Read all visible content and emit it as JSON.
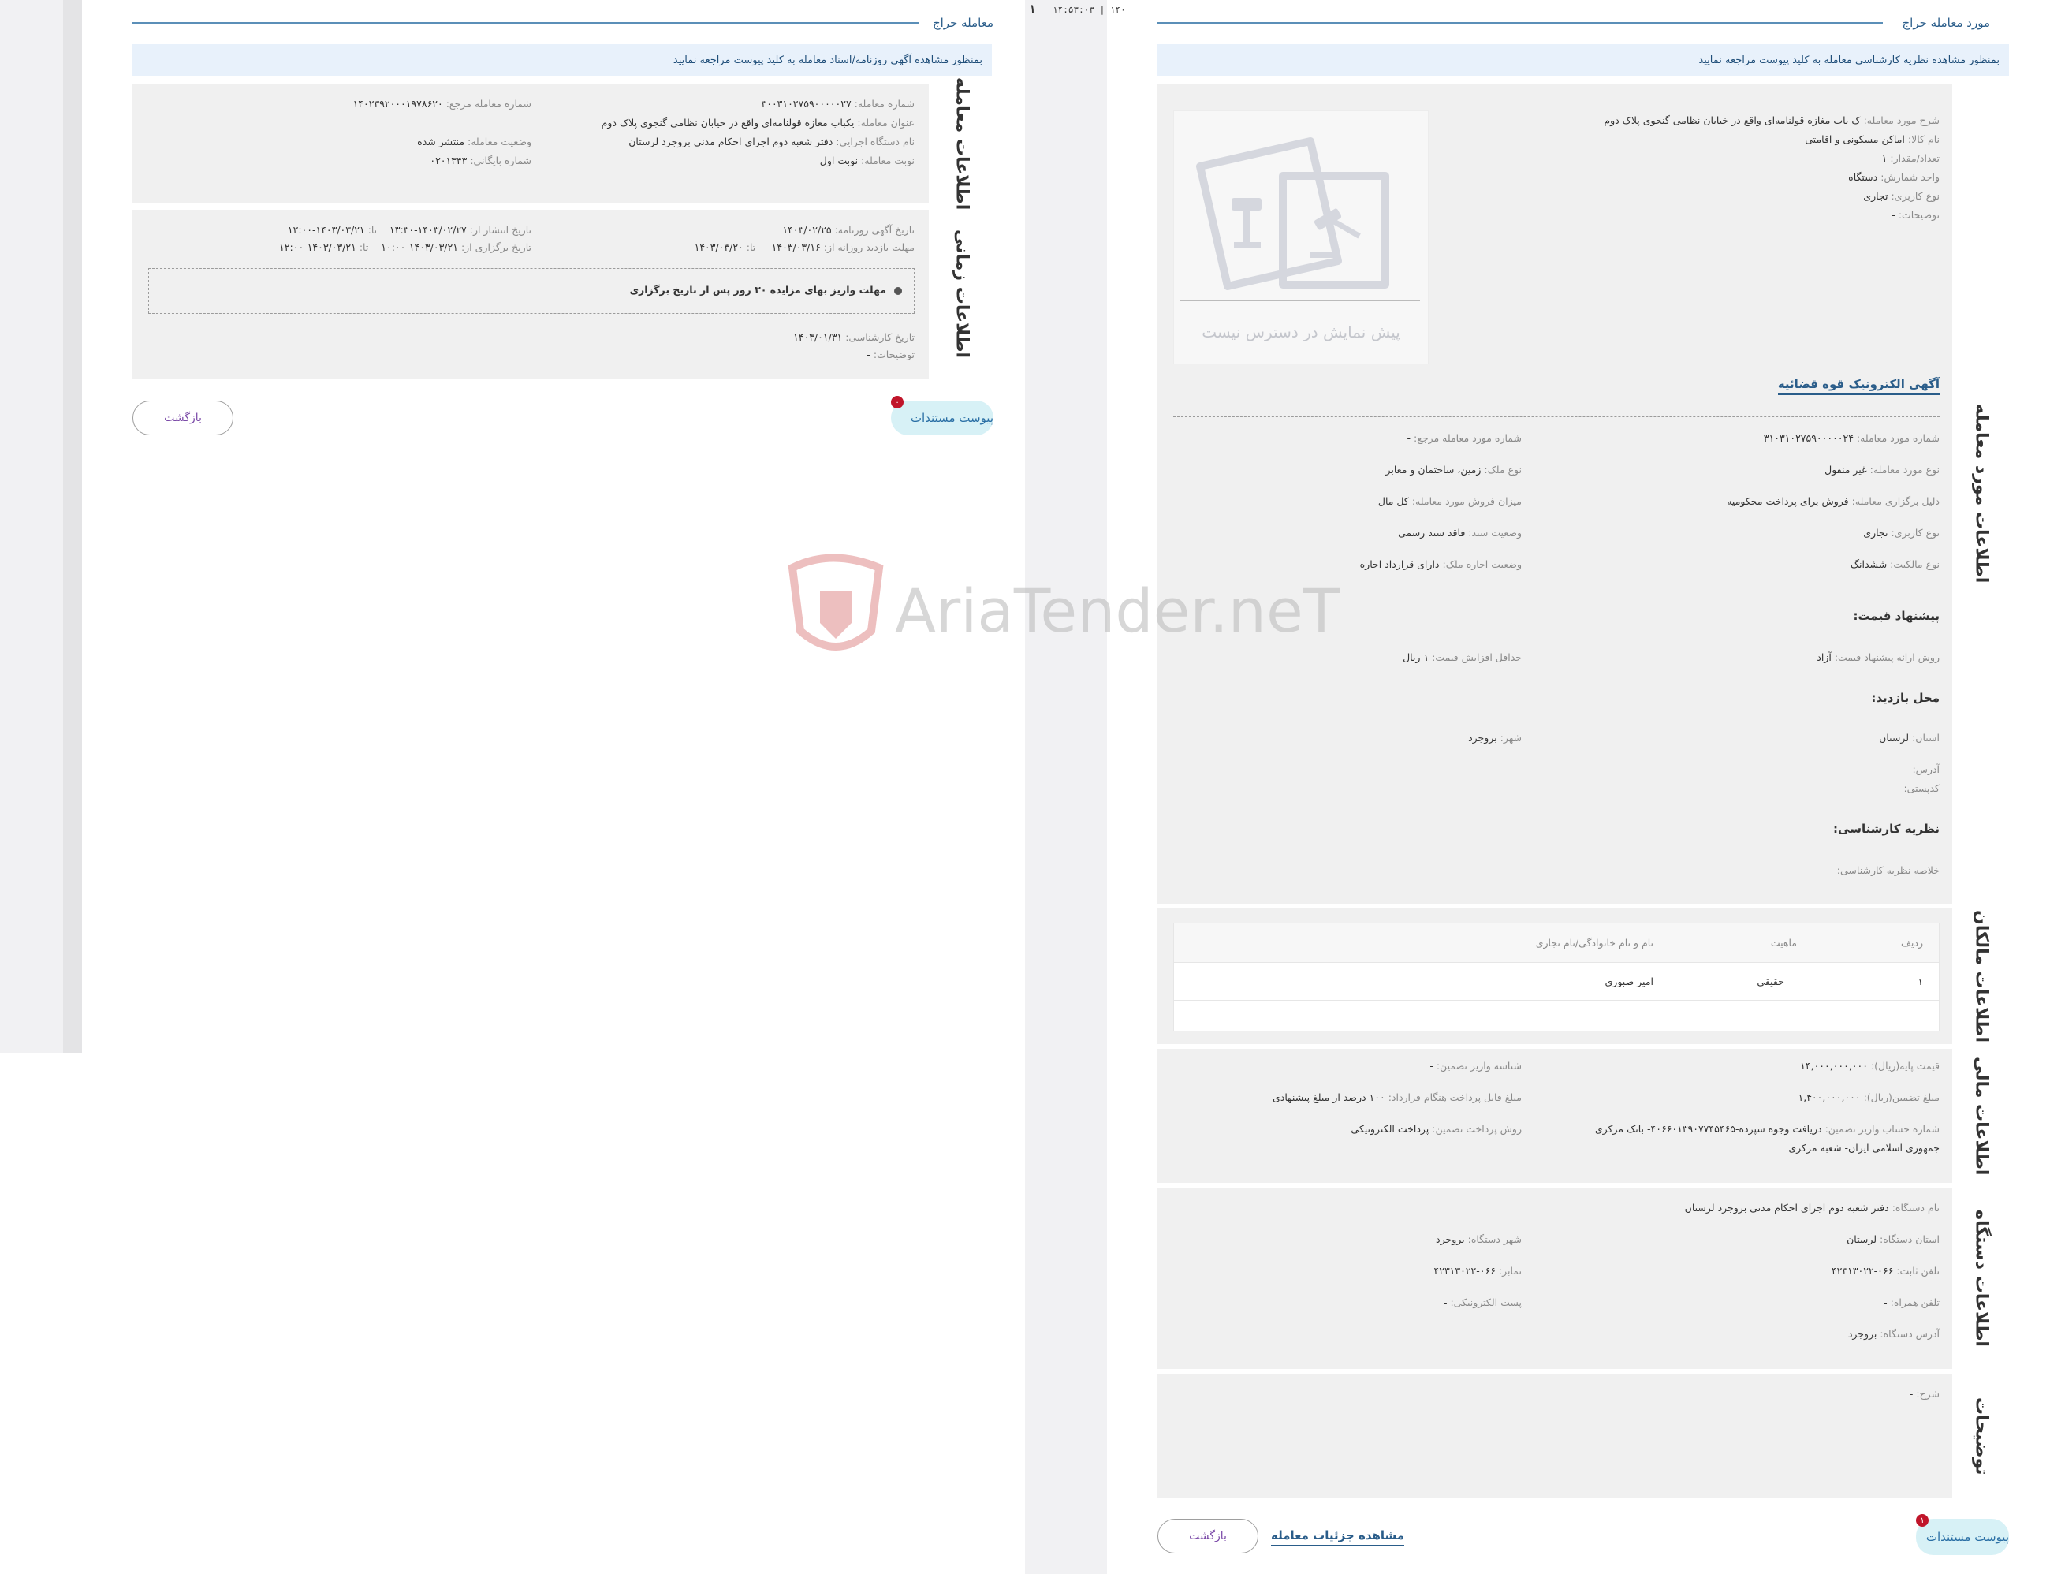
{
  "watermark": {
    "text": "AriaTender.neT"
  },
  "clock": {
    "time": "۱۴:۵۳:۰۳",
    "sep": "|",
    "date_part": "۱۴۰",
    "left_edge": "۱"
  },
  "left": {
    "header_title": "معامله حراج",
    "notice": "بمنظور مشاهده آگهی روزنامه/اسناد معامله به کلید پیوست مراجعه نمایید",
    "deal_info_tab": "اطلاعات معامله",
    "time_info_tab": "اطلاعات زمانی",
    "deal": {
      "deal_number_label": "شماره معامله:",
      "deal_number": "۳۰۰۳۱۰۲۷۵۹۰۰۰۰۰۲۷",
      "ref_number_label": "شماره معامله مرجع:",
      "ref_number": "۱۴۰۲۳۹۲۰۰۰۱۹۷۸۶۲۰",
      "title_label": "عنوان معامله:",
      "title": "یکباب مغازه قولنامه‌ای واقع در خیابان نظامی گنجوی پلاک دوم",
      "status_label": "وضعیت معامله:",
      "status": "منتشر شده",
      "executor_label": "نام دستگاه اجرایی:",
      "executor": "دفتر شعبه دوم اجرای احکام مدنی بروجرد لرستان",
      "archive_label": "شماره بایگانی:",
      "archive": "۰۲۰۱۳۴۳",
      "turn_label": "نوبت معامله:",
      "turn": "نوبت اول"
    },
    "time": {
      "newspaper_date_label": "تاریخ آگهی روزنامه:",
      "newspaper_date": "۱۴۰۳/۰۲/۲۵",
      "publish_from_label": "تاریخ انتشار از:",
      "publish_from": "۱۴۰۳/۰۲/۲۷-۱۳:۳۰",
      "to_label": "تا:",
      "publish_to": "۱۴۰۳/۰۳/۲۱-۱۲:۰۰",
      "visit_label": "مهلت بازدید روزانه از:",
      "visit_from": "۱۴۰۳/۰۳/۱۶-",
      "visit_to": "۱۴۰۳/۰۳/۲۰-",
      "held_label": "تاریخ برگزاری از:",
      "held_from": "۱۴۰۳/۰۳/۲۱-۱۰:۰۰",
      "held_to": "۱۴۰۳/۰۳/۲۱-۱۲:۰۰",
      "deadline_note": "مهلت واریز بهای مزایده ۳۰ روز پس از تاریخ برگزاری",
      "expert_date_label": "تاریخ کارشناسی:",
      "expert_date": "۱۴۰۳/۰۱/۳۱",
      "desc_label": "توضیحات:",
      "desc": "-"
    },
    "attach_label": "پیوست مستندات",
    "attach_badge": "۰",
    "back_label": "بازگشت"
  },
  "right": {
    "header_title": "مورد معامله حراج",
    "notice": "بمنظور مشاهده نظریه کارشناسی معامله به کلید پیوست مراجعه نمایید",
    "tabs": {
      "item": "اطلاعات مورد معامله",
      "owners": "اطلاعات مالکان",
      "finance": "اطلاعات مالی",
      "org": "اطلاعات دستگاه",
      "notes": "توضیحات"
    },
    "item": {
      "desc_label": "شرح مورد معامله:",
      "desc": "ک باب مغازه قولنامه‌ای واقع در خیابان نظامی گنجوی پلاک دوم",
      "goods_label": "نام کالا:",
      "goods": "اماکن مسکونی و اقامتی",
      "qty_label": "تعداد/مقدار:",
      "qty": "۱",
      "unit_label": "واحد شمارش:",
      "unit": "دستگاه",
      "use_label": "نوع کاربری:",
      "use": "تجاری",
      "note_label": "توضیحات:",
      "note": "-",
      "preview_text": "پیش نمایش در دسترس نیست",
      "court_ad_link": "آگهی الکترونیک قوه قضائیه",
      "item_no_label": "شماره مورد معامله:",
      "item_no": "۳۱۰۳۱۰۲۷۵۹۰۰۰۰۰۲۴",
      "ref_item_label": "شماره مورد معامله مرجع:",
      "ref_item": "-",
      "type_label": "نوع مورد معامله:",
      "type": "غیر منقول",
      "prop_label": "نوع ملک:",
      "prop": "زمین، ساختمان و معابر",
      "reason_label": "دلیل برگزاری معامله:",
      "reason": "فروش برای پرداخت محکومیه",
      "sale_label": "میزان فروش مورد معامله:",
      "sale": "کل مال",
      "use2_label": "نوع کاربری:",
      "use2": "تجاری",
      "doc_label": "وضعیت سند:",
      "doc": "فاقد سند رسمی",
      "owner_type_label": "نوع مالکیت:",
      "owner_type": "ششدانگ",
      "lease_label": "وضعیت اجاره ملک:",
      "lease": "دارای قرارداد اجاره",
      "price_head": "پیشنهاد قیمت:",
      "method_label": "روش ارائه پیشنهاد قیمت:",
      "method": "آزاد",
      "min_inc_label": "حداقل افزایش قیمت:",
      "min_inc": "۱ ریال",
      "visit_head": "محل بازدید:",
      "province_label": "استان:",
      "province": "لرستان",
      "city_label": "شهر:",
      "city": "بروجرد",
      "addr_label": "آدرس:",
      "addr": "-",
      "postal_label": "کدپستی:",
      "postal": "-",
      "expert_head": "نظریه کارشناسی:",
      "expert_sum_label": "خلاصه نظریه کارشناسی:",
      "expert_sum": "-"
    },
    "owners": {
      "columns": [
        "ردیف",
        "ماهیت",
        "نام و نام خانوادگی/نام تجاری"
      ],
      "rows": [
        [
          "۱",
          "حقیقی",
          "امیر صبوری"
        ]
      ]
    },
    "finance": {
      "base_label": "قیمت پایه(ریال):",
      "base": "۱۴,۰۰۰,۰۰۰,۰۰۰",
      "guar_id_label": "شناسه واریز تضمین:",
      "guar_id": "-",
      "guar_label": "مبلغ تضمین(ریال):",
      "guar": "۱,۴۰۰,۰۰۰,۰۰۰",
      "payable_label": "مبلغ قابل پرداخت هنگام قرارداد:",
      "payable": "۱۰۰ درصد از مبلغ پیشنهادی",
      "account_label": "شماره حساب واریز تضمین:",
      "account": "دریافت وجوه سپرده-۴۰۶۶۰۱۳۹۰۷۷۴۵۴۶۵- بانک مرکزی",
      "account2": "جمهوری اسلامی ایران- شعبه مرکزی",
      "pay_method_label": "روش پرداخت تضمین:",
      "pay_method": "پرداخت الکترونیکی"
    },
    "org": {
      "name_label": "نام دستگاه:",
      "name": "دفتر شعبه دوم اجرای احکام مدنی بروجرد لرستان",
      "province_label": "استان دستگاه:",
      "province": "لرستان",
      "city_label": "شهر دستگاه:",
      "city": "بروجرد",
      "phone_label": "تلفن ثابت:",
      "phone": "۰۶۶-۴۲۳۱۳۰۲۲",
      "fax_label": "نمابر:",
      "fax": "۰۶۶-۴۲۳۱۳۰۲۲",
      "mobile_label": "تلفن همراه:",
      "mobile": "-",
      "email_label": "پست الکترونیکی:",
      "email": "-",
      "address_label": "آدرس دستگاه:",
      "address": "بروجرد"
    },
    "notes": {
      "desc_label": "شرح:",
      "desc": "-"
    },
    "attach_label": "پیوست مستندات",
    "attach_badge": "۱",
    "back_label": "بازگشت",
    "details_link": "مشاهده جزئیات معامله"
  }
}
